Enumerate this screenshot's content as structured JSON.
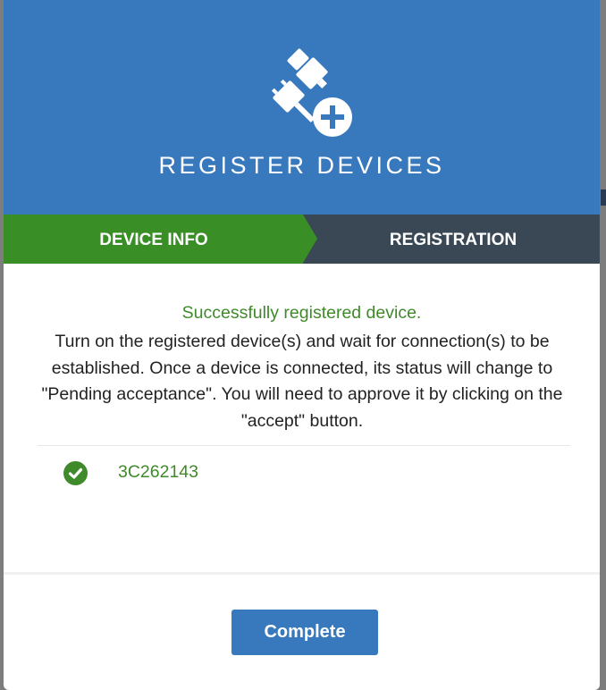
{
  "header": {
    "icon": "plug-plus-icon",
    "title": "REGISTER DEVICES",
    "color": "#3878bd"
  },
  "steps": [
    {
      "label": "DEVICE INFO",
      "state": "completed",
      "color": "#3a8e26"
    },
    {
      "label": "REGISTRATION",
      "state": "current",
      "color": "#3a4855"
    }
  ],
  "content": {
    "success_message": "Successfully registered device.",
    "instructions": "Turn on the registered device(s) and wait for connection(s) to be established. Once a device is connected, its status will change to \"Pending acceptance\". You will need to approve it by clicking on the \"accept\" button.",
    "devices": [
      {
        "id": "3C262143",
        "status_icon": "check-circle-icon",
        "status_color": "#3f8a2a"
      }
    ]
  },
  "footer": {
    "complete_label": "Complete"
  }
}
